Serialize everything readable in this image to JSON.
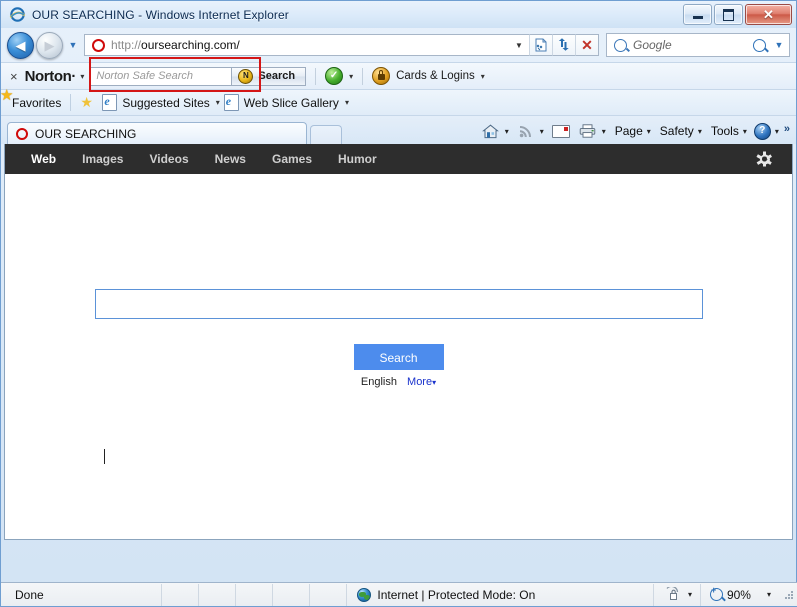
{
  "window": {
    "title": "OUR SEARCHING - Windows Internet Explorer",
    "ie_icon": "internet-explorer-icon",
    "minimize_label": "–",
    "maximize_label": "□",
    "close_label": "✕"
  },
  "toolbar": {
    "back_label": "◀",
    "forward_label": "▶",
    "history_caret": "▼",
    "url_scheme": "http://",
    "url_host": "oursearching.com/",
    "url_dropdown": "▼",
    "compat_icon": "compatibility-view-icon",
    "refresh_icon": "refresh-icon",
    "stop_label": "✕",
    "search_placeholder": "Google",
    "search_go_icon": "search-icon",
    "search_caret": "▼"
  },
  "norton": {
    "close_label": "×",
    "brand": "Norton",
    "brand_dot": "·",
    "brand_caret": "▾",
    "search_placeholder": "Norton Safe Search",
    "search_button": "Search",
    "search_button_icon": "N",
    "safe_icon": "green-check-icon",
    "safe_caret": "▾",
    "cards_icon": "lock-icon",
    "cards_label": "Cards & Logins",
    "cards_caret": "▾"
  },
  "favorites_bar": {
    "favorites_label": "Favorites",
    "favorites_icon": "star-icon",
    "add_icon": "add-to-favorites-icon",
    "items": [
      {
        "label": "Suggested Sites",
        "icon": "ie-page-icon",
        "caret": "▾"
      },
      {
        "label": "Web Slice Gallery",
        "icon": "ie-page-icon",
        "caret": "▾"
      }
    ]
  },
  "tabs": {
    "active": {
      "label": "OUR SEARCHING",
      "favicon": "red-o-favicon"
    },
    "new_tab_label": ""
  },
  "command_bar": {
    "home_icon": "home-icon",
    "home_caret": "▾",
    "feeds_icon": "rss-icon",
    "feeds_caret": "▾",
    "mail_icon": "mail-icon",
    "print_icon": "print-icon",
    "print_caret": "▾",
    "page_label": "Page",
    "page_caret": "▾",
    "safety_label": "Safety",
    "safety_caret": "▾",
    "tools_label": "Tools",
    "tools_caret": "▾",
    "help_icon": "?",
    "help_caret": "▾",
    "overflow_label": "»"
  },
  "page": {
    "nav": [
      {
        "label": "Web",
        "active": true
      },
      {
        "label": "Images",
        "active": false
      },
      {
        "label": "Videos",
        "active": false
      },
      {
        "label": "News",
        "active": false
      },
      {
        "label": "Games",
        "active": false
      },
      {
        "label": "Humor",
        "active": false
      }
    ],
    "settings_icon": "gear-icon",
    "search_value": "",
    "search_placeholder": "",
    "search_button": "Search",
    "language": "English",
    "more_label": "More",
    "more_caret": "▾"
  },
  "status_bar": {
    "status_text": "Done",
    "zone_icon": "internet-zone-icon",
    "zone_text": "Internet | Protected Mode: On",
    "protected_icon": "protected-mode-icon",
    "protected_caret": "▾",
    "zoom_icon": "zoom-icon",
    "zoom_level": "90%",
    "zoom_caret": "▾"
  },
  "colors": {
    "nav_bg": "#2d2d2d",
    "search_button": "#4d8ced",
    "link_blue": "#1a33cc",
    "annotation_red": "#d41616",
    "norton_gold": "#e0a021"
  }
}
